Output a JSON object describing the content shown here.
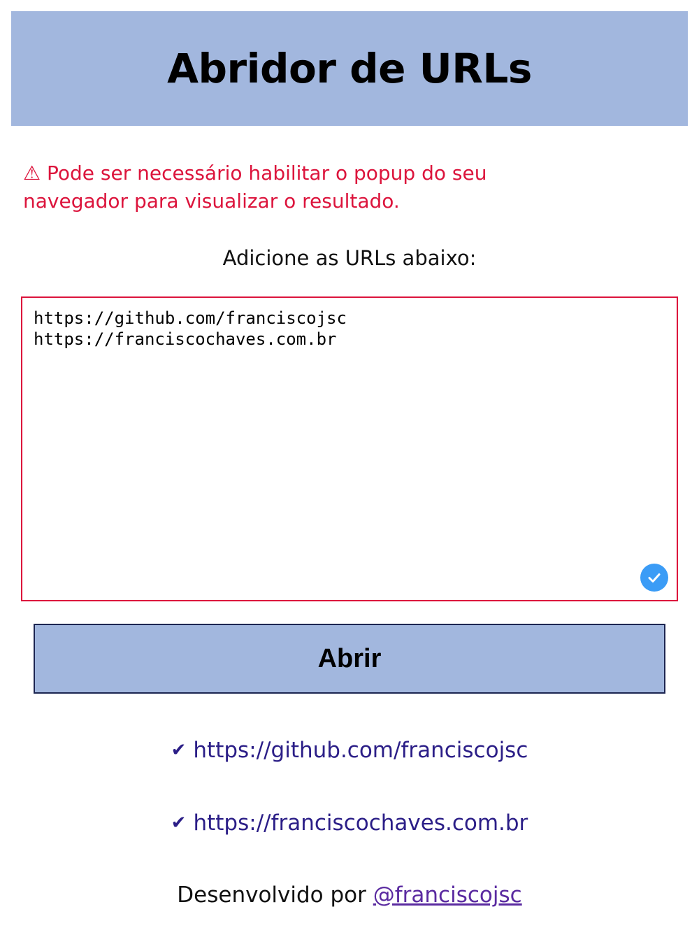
{
  "header": {
    "title": "Abridor de URLs"
  },
  "warning": {
    "icon": "⚠",
    "text": "Pode ser necessário habilitar o popup do seu navegador para visualizar o resultado."
  },
  "instruction": "Adicione as URLs abaixo:",
  "textarea": {
    "value": "https://github.com/franciscojsc\nhttps://franciscochaves.com.br"
  },
  "open_button": {
    "label": "Abrir"
  },
  "results": [
    {
      "check": "✅",
      "url": "https://github.com/franciscojsc"
    },
    {
      "check": "✅",
      "url": "https://franciscochaves.com.br"
    }
  ],
  "footer": {
    "text": "Desenvolvido por ",
    "link_label": "@franciscojsc"
  },
  "colors": {
    "header_bg": "#a2b7de",
    "warning": "#dc143c",
    "link": "#2b1e87",
    "button_border": "#1c2551",
    "badge": "#3b9cf6"
  }
}
